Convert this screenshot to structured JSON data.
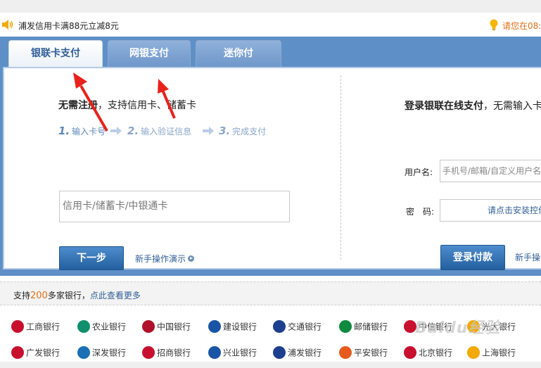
{
  "notice": {
    "promo_text": "浦发信用卡满88元立减8元",
    "time_text": "请您在08:"
  },
  "tabs": [
    {
      "label": "银联卡支付",
      "active": true
    },
    {
      "label": "网银支付",
      "active": false
    },
    {
      "label": "迷你付",
      "active": false
    }
  ],
  "left_panel": {
    "title_bold": "无需注册",
    "title_rest": "，支持信用卡、储蓄卡",
    "steps": [
      {
        "num": "1.",
        "label": "输入卡号"
      },
      {
        "num": "2.",
        "label": "输入验证信息"
      },
      {
        "num": "3.",
        "label": "完成支付"
      }
    ],
    "card_placeholder": "信用卡/储蓄卡/中银通卡",
    "next_label": "下一步",
    "demo_label": "新手操作演示"
  },
  "right_panel": {
    "title_bold": "登录银联在线支付",
    "title_rest": "，无需输入卡号",
    "username_label": "用户名:",
    "username_placeholder": "手机号/邮箱/自定义用户名",
    "password_label": "密　码:",
    "password_hint": "请点击安装控件",
    "login_label": "登录付款",
    "demo_label": "新手操作"
  },
  "banks": {
    "header_prefix": "支持",
    "count": "200",
    "header_suffix": "多家银行，",
    "more_link": "点此查看更多",
    "row1": [
      {
        "name": "工商银行",
        "color": "#c8102e",
        "icon": "icbc-logo"
      },
      {
        "name": "农业银行",
        "color": "#0f8f6b",
        "icon": "abc-logo"
      },
      {
        "name": "中国银行",
        "color": "#b0102a",
        "icon": "boc-logo"
      },
      {
        "name": "建设银行",
        "color": "#1a54a5",
        "icon": "ccb-logo"
      },
      {
        "name": "交通银行",
        "color": "#1d3f8f",
        "icon": "bocom-logo"
      },
      {
        "name": "邮储银行",
        "color": "#0e8a3f",
        "icon": "psbc-logo"
      },
      {
        "name": "中信银行",
        "color": "#c8102e",
        "icon": "citic-logo"
      },
      {
        "name": "光大银行",
        "color": "#f2a900",
        "icon": "ceb-logo"
      }
    ],
    "row2": [
      {
        "name": "广发银行",
        "color": "#c8102e",
        "icon": "cgb-logo"
      },
      {
        "name": "深发银行",
        "color": "#1a6fb5",
        "icon": "sdb-logo"
      },
      {
        "name": "招商银行",
        "color": "#c8102e",
        "icon": "cmb-logo"
      },
      {
        "name": "兴业银行",
        "color": "#1a54a5",
        "icon": "cib-logo"
      },
      {
        "name": "浦发银行",
        "color": "#1d3f8f",
        "icon": "spdb-logo"
      },
      {
        "name": "平安银行",
        "color": "#e65a1e",
        "icon": "pingan-logo"
      },
      {
        "name": "北京银行",
        "color": "#c8102e",
        "icon": "bob-logo"
      },
      {
        "name": "上海银行",
        "color": "#f2a900",
        "icon": "bos-logo"
      }
    ]
  },
  "watermark": "Baidu经验",
  "colors": {
    "panel_blue": "#5f8fc7",
    "button_blue": "#23609f",
    "accent_orange": "#e0701a",
    "annotation_red": "#e8221c"
  }
}
